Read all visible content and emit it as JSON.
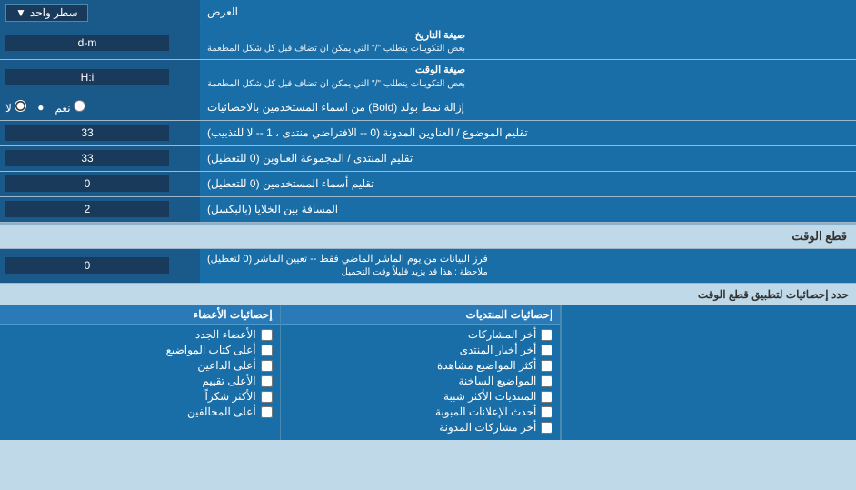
{
  "title": "العرض",
  "rows": [
    {
      "id": "row-single-line",
      "label": "",
      "input_type": "select",
      "input_value": "سطر واحد",
      "label_text": "العرض"
    },
    {
      "id": "row-date-format",
      "label_main": "صيغة التاريخ",
      "label_sub": "بعض التكوينات يتطلب \"/\" التي يمكن ان تضاف قبل كل شكل المطعمة",
      "input_value": "d-m",
      "input_type": "text"
    },
    {
      "id": "row-time-format",
      "label_main": "صيغة الوقت",
      "label_sub": "بعض التكوينات يتطلب \"/\" التي يمكن ان تضاف قبل كل شكل المطعمة",
      "input_value": "H:i",
      "input_type": "text"
    },
    {
      "id": "row-bold",
      "label": "إزالة نمط بولد (Bold) من اسماء المستخدمين بالاحصائيات",
      "radio_yes": "نعم",
      "radio_no": "لا",
      "selected": "no"
    },
    {
      "id": "row-topics-trim",
      "label": "تقليم الموضوع / العناوين المدونة (0 -- الافتراضي منتدى ، 1 -- لا للتذبيب)",
      "input_value": "33",
      "input_type": "text"
    },
    {
      "id": "row-forum-trim",
      "label": "تقليم المنتدى / المجموعة العناوين (0 للتعطيل)",
      "input_value": "33",
      "input_type": "text"
    },
    {
      "id": "row-users-trim",
      "label": "تقليم أسماء المستخدمين (0 للتعطيل)",
      "input_value": "0",
      "input_type": "text"
    },
    {
      "id": "row-gap",
      "label": "المسافة بين الخلايا (بالبكسل)",
      "input_value": "2",
      "input_type": "text"
    }
  ],
  "section_snapshot": "قطع الوقت",
  "row_snapshot": {
    "label_main": "فرز البيانات من يوم الماشر الماضي فقط -- تعيين الماشر (0 لتعطيل)",
    "label_note": "ملاحظة : هذا قد يزيد قليلاً وقت التحميل",
    "input_value": "0"
  },
  "stats_header_label": "حدد إحصائيات لتطبيق قطع الوقت",
  "col1_header": "إحصائيات المنتديات",
  "col2_header": "إحصائيات الأعضاء",
  "col1_items": [
    "أخر المشاركات",
    "أخر أخبار المنتدى",
    "أكثر المواضيع مشاهدة",
    "المواضيع الساخنة",
    "المنتديات الأكثر شببة",
    "أحدث الإعلانات المبوبة",
    "أخر مشاركات المدونة"
  ],
  "col2_items": [
    "الأعضاء الجدد",
    "أعلى كتاب المواضيع",
    "أعلى الداعين",
    "الأعلى تقييم",
    "الأكثر شكراً",
    "أعلى المخالفين"
  ]
}
